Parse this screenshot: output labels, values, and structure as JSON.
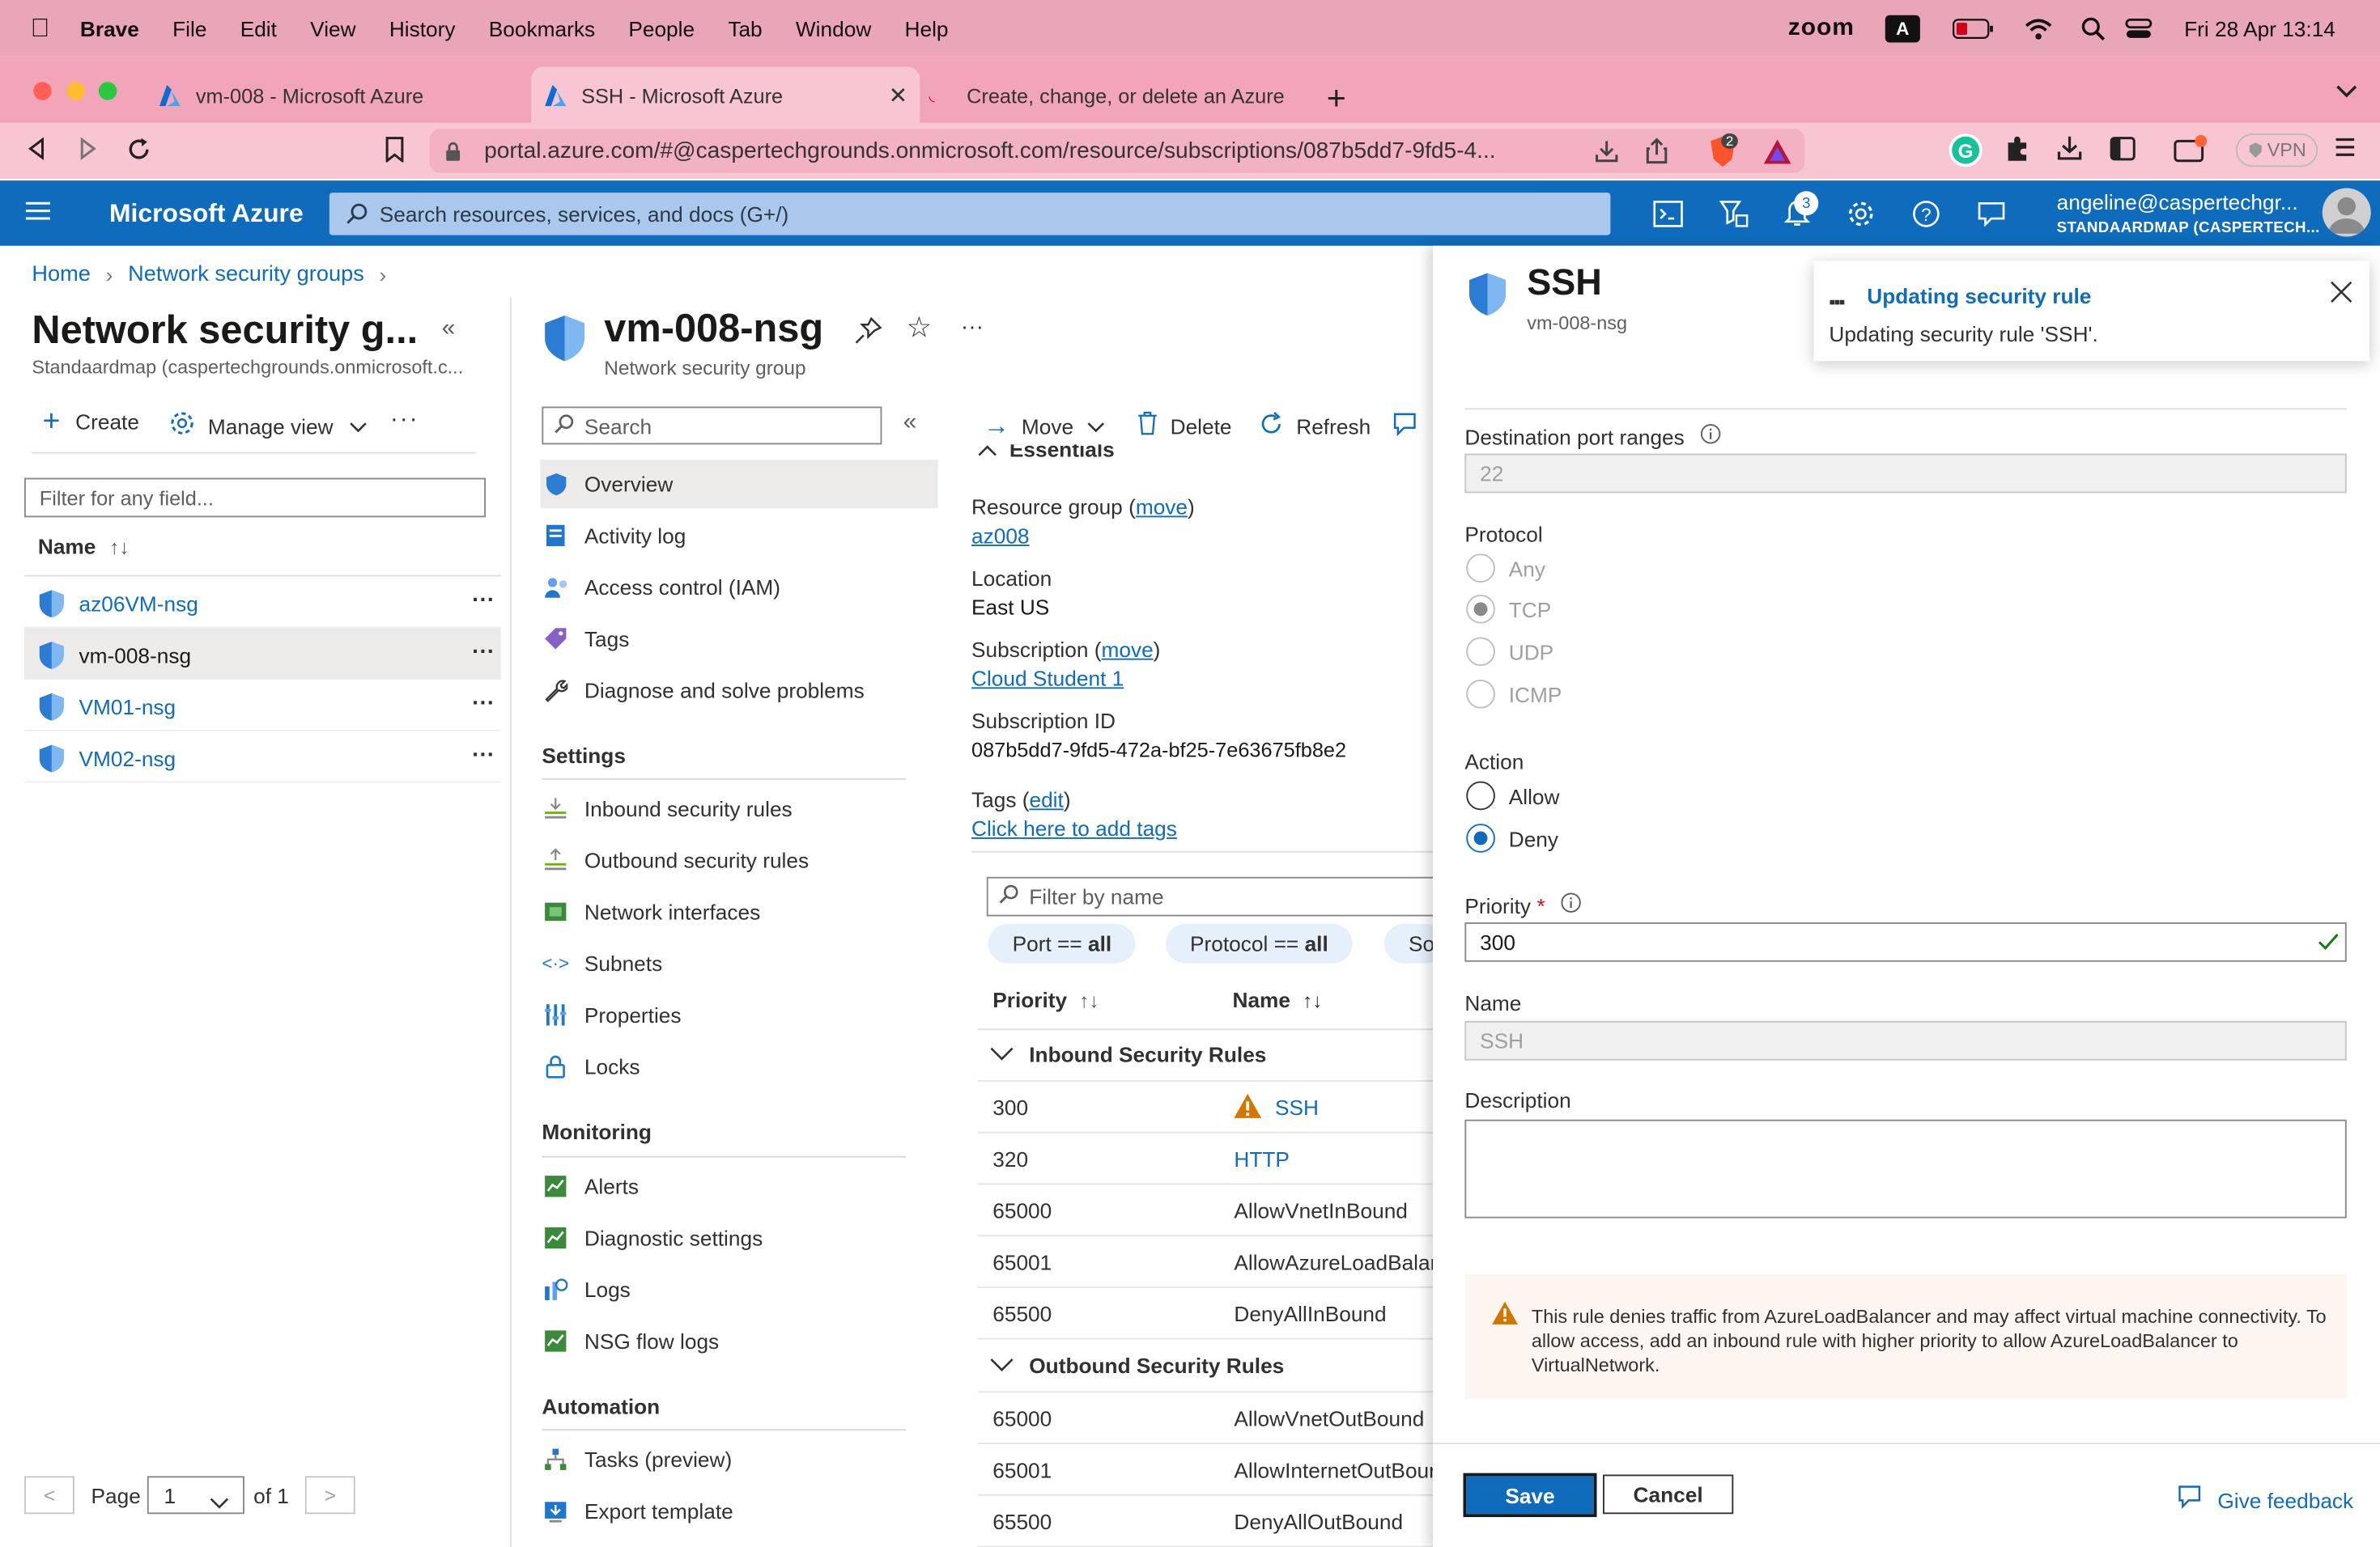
{
  "menubar": {
    "app": "Brave",
    "items": [
      "File",
      "Edit",
      "View",
      "History",
      "Bookmarks",
      "People",
      "Tab",
      "Window",
      "Help"
    ],
    "zoom": "zoom",
    "input_badge": "A",
    "datetime": "Fri 28 Apr  13:14"
  },
  "tabs": [
    {
      "title": "vm-008 - Microsoft Azure"
    },
    {
      "title": "SSH - Microsoft Azure"
    },
    {
      "title": "Create, change, or delete an Azure"
    }
  ],
  "address": {
    "url": "portal.azure.com/#@caspertechgrounds.onmicrosoft.com/resource/subscriptions/087b5dd7-9fd5-4...",
    "vpn": "VPN",
    "brave_badge": "2"
  },
  "azure": {
    "brand": "Microsoft Azure",
    "search_placeholder": "Search resources, services, and docs (G+/)",
    "notif_count": "3",
    "user_name": "angeline@caspertechgr...",
    "user_dir": "STANDAARDMAP (CASPERTECH..."
  },
  "breadcrumb": {
    "home": "Home",
    "nsg": "Network security groups"
  },
  "list_panel": {
    "title": "Network security g...",
    "subtitle": "Standaardmap (caspertechgrounds.onmicrosoft.c...",
    "create": "Create",
    "manage_view": "Manage view",
    "filter_placeholder": "Filter for any field...",
    "col_name": "Name",
    "items": [
      "az06VM-nsg",
      "vm-008-nsg",
      "VM01-nsg",
      "VM02-nsg"
    ],
    "page_label": "Page",
    "page_value": "1",
    "of_label": "of 1"
  },
  "resource": {
    "title": "vm-008-nsg",
    "subtitle": "Network security group",
    "search_placeholder": "Search",
    "nav": {
      "overview": "Overview",
      "activity": "Activity log",
      "iam": "Access control (IAM)",
      "tags": "Tags",
      "diagnose": "Diagnose and solve problems",
      "settings_head": "Settings",
      "inbound": "Inbound security rules",
      "outbound": "Outbound security rules",
      "nics": "Network interfaces",
      "subnets": "Subnets",
      "properties": "Properties",
      "locks": "Locks",
      "monitoring_head": "Monitoring",
      "alerts": "Alerts",
      "diag_settings": "Diagnostic settings",
      "logs": "Logs",
      "flow_logs": "NSG flow logs",
      "automation_head": "Automation",
      "tasks": "Tasks (preview)",
      "export": "Export template"
    },
    "toolbar": {
      "move": "Move",
      "delete": "Delete",
      "refresh": "Refresh"
    },
    "essentials": "Essentials",
    "rg_label": "Resource group (",
    "rg_move": "move",
    "rg_value": "az008",
    "location_label": "Location",
    "location_value": "East US",
    "sub_label": "Subscription (",
    "sub_move": "move",
    "sub_value": "Cloud Student 1",
    "subid_label": "Subscription ID",
    "subid_value": "087b5dd7-9fd5-472a-bf25-7e63675fb8e2",
    "tags_label": "Tags (",
    "tags_edit": "edit",
    "tags_add": "Click here to add tags",
    "filter_placeholder": "Filter by name",
    "pills": {
      "port_pre": "Port == ",
      "port_val": "all",
      "proto_pre": "Protocol == ",
      "proto_val": "all",
      "source": "So"
    },
    "col_priority": "Priority",
    "col_name": "Name",
    "inbound_head": "Inbound Security Rules",
    "outbound_head": "Outbound Security Rules",
    "inbound": [
      {
        "priority": "300",
        "name": "SSH"
      },
      {
        "priority": "320",
        "name": "HTTP"
      },
      {
        "priority": "65000",
        "name": "AllowVnetInBound"
      },
      {
        "priority": "65001",
        "name": "AllowAzureLoadBalan"
      },
      {
        "priority": "65500",
        "name": "DenyAllInBound"
      }
    ],
    "outbound": [
      {
        "priority": "65000",
        "name": "AllowVnetOutBound"
      },
      {
        "priority": "65001",
        "name": "AllowInternetOutBour"
      },
      {
        "priority": "65500",
        "name": "DenyAllOutBound"
      }
    ]
  },
  "blade": {
    "title": "SSH",
    "subtitle": "vm-008-nsg",
    "dest_ports_label": "Destination port ranges",
    "dest_ports_value": "22",
    "protocol_label": "Protocol",
    "protocols": [
      "Any",
      "TCP",
      "UDP",
      "ICMP"
    ],
    "action_label": "Action",
    "actions": [
      "Allow",
      "Deny"
    ],
    "priority_label": "Priority",
    "priority_required": "*",
    "priority_value": "300",
    "name_label": "Name",
    "name_value": "SSH",
    "desc_label": "Description",
    "warning": "This rule denies traffic from AzureLoadBalancer and may affect virtual machine connectivity. To allow access, add an inbound rule with higher priority to allow AzureLoadBalancer to VirtualNetwork.",
    "save": "Save",
    "cancel": "Cancel",
    "feedback": "Give feedback"
  },
  "toast": {
    "title": "Updating security rule",
    "message": "Updating security rule 'SSH'."
  }
}
